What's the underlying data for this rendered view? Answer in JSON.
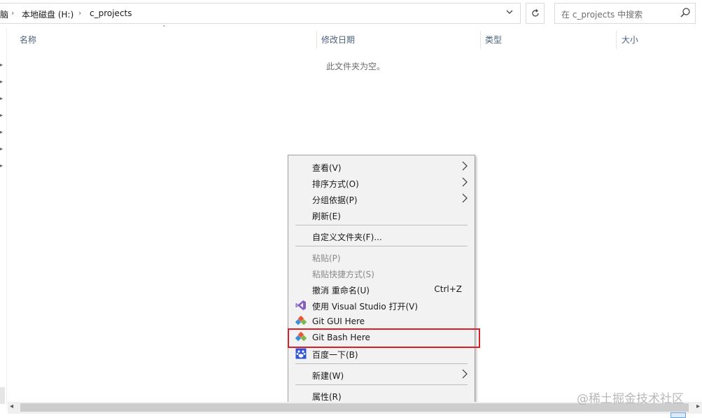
{
  "address": {
    "crumbs": [
      "脑",
      "本地磁盘 (H:)",
      "c_projects"
    ]
  },
  "search": {
    "placeholder": "在 c_projects 中搜索"
  },
  "columns": [
    "名称",
    "修改日期",
    "类型",
    "大小"
  ],
  "empty_message": "此文件夹为空。",
  "context_menu": {
    "items": [
      {
        "label": "查看(V)",
        "submenu": true
      },
      {
        "label": "排序方式(O)",
        "submenu": true
      },
      {
        "label": "分组依据(P)",
        "submenu": true
      },
      {
        "label": "刷新(E)"
      },
      {
        "label": "自定义文件夹(F)..."
      },
      {
        "label": "粘贴(P)",
        "disabled": true
      },
      {
        "label": "粘贴快捷方式(S)",
        "disabled": true
      },
      {
        "label": "撤消 重命名(U)",
        "shortcut": "Ctrl+Z"
      },
      {
        "label": "使用 Visual Studio 打开(V)",
        "icon": "visual-studio-icon"
      },
      {
        "label": "Git GUI Here",
        "icon": "git-icon"
      },
      {
        "label": "Git Bash Here",
        "icon": "git-icon"
      },
      {
        "label": "百度一下(B)",
        "icon": "baidu-icon"
      },
      {
        "label": "新建(W)",
        "submenu": true
      },
      {
        "label": "属性(R)"
      }
    ]
  },
  "watermark": "@稀土掘金技术社区",
  "colors": {
    "highlight": "#d9202a",
    "header_text": "#4c607a",
    "vs_purple": "#865fc5"
  }
}
